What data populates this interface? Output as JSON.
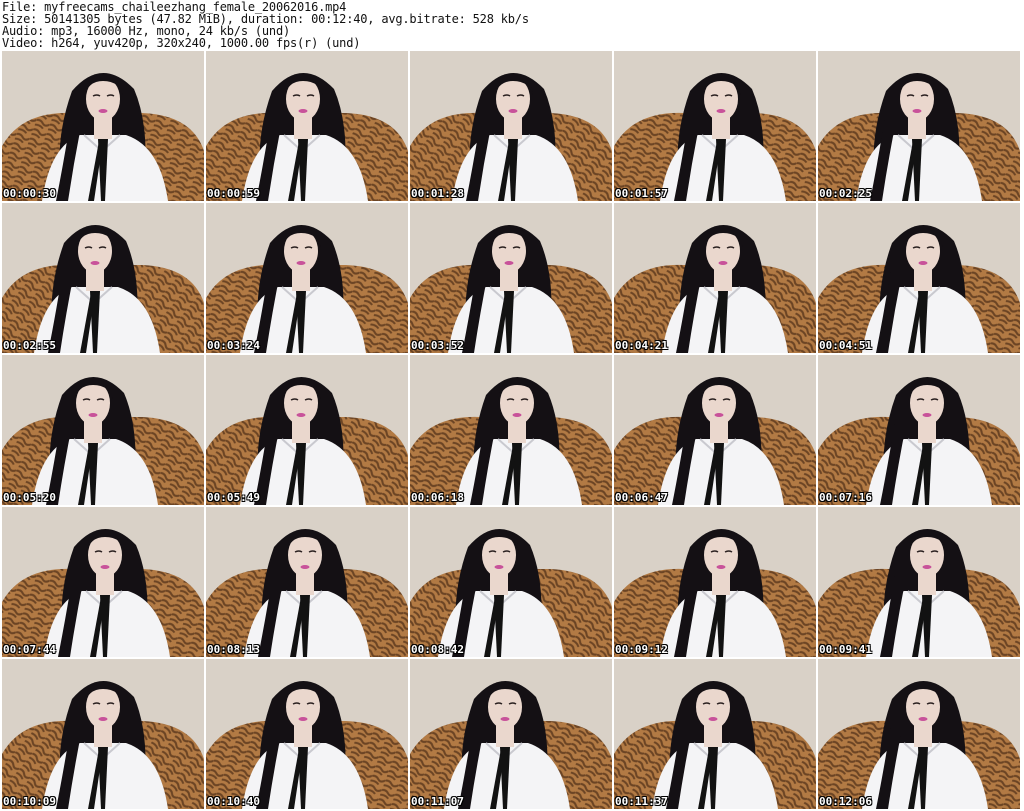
{
  "info": {
    "file": "File: myfreecams_chaileezhang_female_20062016.mp4",
    "size": "Size: 50141305 bytes (47.82 MiB), duration: 00:12:40, avg.bitrate: 528 kb/s",
    "audio": "Audio: mp3, 16000 Hz, mono, 24 kb/s (und)",
    "video": "Video: h264, yuv420p, 320x240, 1000.00 fps(r) (und)"
  },
  "thumbnails": [
    {
      "time": "00:00:30"
    },
    {
      "time": "00:00:59"
    },
    {
      "time": "00:01:28"
    },
    {
      "time": "00:01:57"
    },
    {
      "time": "00:02:25"
    },
    {
      "time": "00:02:55"
    },
    {
      "time": "00:03:24"
    },
    {
      "time": "00:03:52"
    },
    {
      "time": "00:04:21"
    },
    {
      "time": "00:04:51"
    },
    {
      "time": "00:05:20"
    },
    {
      "time": "00:05:49"
    },
    {
      "time": "00:06:18"
    },
    {
      "time": "00:06:47"
    },
    {
      "time": "00:07:16"
    },
    {
      "time": "00:07:44"
    },
    {
      "time": "00:08:13"
    },
    {
      "time": "00:08:42"
    },
    {
      "time": "00:09:12"
    },
    {
      "time": "00:09:41"
    },
    {
      "time": "00:10:09"
    },
    {
      "time": "00:10:40"
    },
    {
      "time": "00:11:07"
    },
    {
      "time": "00:11:37"
    },
    {
      "time": "00:12:06"
    }
  ],
  "colors": {
    "wall": "#d9d1c7",
    "chair": "#b27a44",
    "chair_dark": "#6b4424",
    "hair": "#141014",
    "skin": "#ead7cd",
    "shirt": "#f4f4f6",
    "tie": "#121212",
    "lips": "#c8529a"
  }
}
